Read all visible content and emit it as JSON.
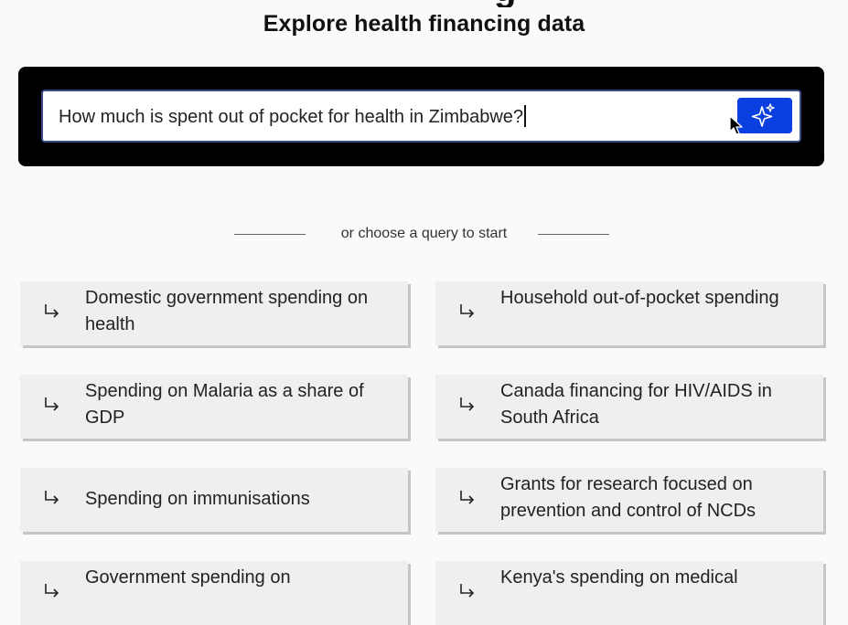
{
  "header": {
    "title": "Explore health financing data"
  },
  "search": {
    "value": "How much is spent out of pocket for health in Zimbabwe?"
  },
  "divider": {
    "text": "or choose a query to start"
  },
  "queries": [
    "Domestic government spending on health",
    "Household out-of-pocket spending",
    "Spending on Malaria as a share of GDP",
    "Canada financing for HIV/AIDS in South Africa",
    "Spending on immunisations",
    "Grants for research focused on prevention and control of NCDs",
    "Government spending on",
    "Kenya's spending on medical"
  ],
  "icons": {
    "ask_button": "sparkle-icon",
    "query_arrow": "arrow-turn-down-right-icon",
    "pointer": "mouse-pointer-icon"
  },
  "colors": {
    "background": "#fafafa",
    "panel": "#000000",
    "button": "#0a3fe0",
    "card": "#efefef",
    "input_border": "#3a4a86"
  }
}
